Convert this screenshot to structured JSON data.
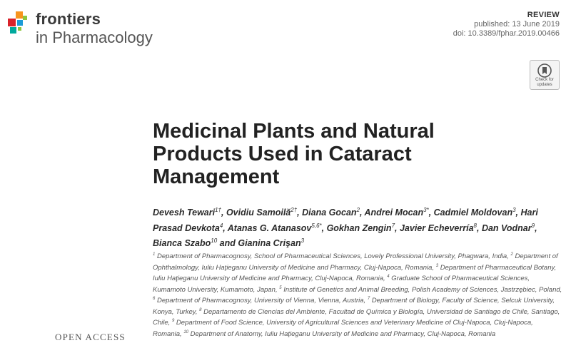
{
  "header": {
    "brand": "frontiers",
    "journal": "in Pharmacology",
    "article_type": "REVIEW",
    "published": "published: 13 June 2019",
    "doi": "doi: 10.3389/fphar.2019.00466"
  },
  "check_updates": {
    "label": "Check for updates"
  },
  "article": {
    "title": "Medicinal Plants and Natural Products Used in Cataract Management"
  },
  "authors": [
    {
      "name": "Devesh Tewari",
      "sup": "1†",
      "sep": ", "
    },
    {
      "name": "Ovidiu Samoilă",
      "sup": "2†",
      "sep": ", "
    },
    {
      "name": "Diana Gocan",
      "sup": "2",
      "sep": ", "
    },
    {
      "name": "Andrei Mocan",
      "sup": "3*",
      "sep": ", "
    },
    {
      "name": "Cadmiel Moldovan",
      "sup": "3",
      "sep": ", "
    },
    {
      "name": "Hari Prasad Devkota",
      "sup": "4",
      "sep": ", "
    },
    {
      "name": "Atanas G. Atanasov",
      "sup": "5,6*",
      "sep": ", "
    },
    {
      "name": "Gokhan Zengin",
      "sup": "7",
      "sep": ", "
    },
    {
      "name": "Javier Echeverría",
      "sup": "8",
      "sep": ", "
    },
    {
      "name": "Dan Vodnar",
      "sup": "9",
      "sep": ", "
    },
    {
      "name": "Bianca Szabo",
      "sup": "10",
      "sep": " and "
    },
    {
      "name": "Gianina Crişan",
      "sup": "3",
      "sep": ""
    }
  ],
  "affiliations": [
    {
      "num": "1",
      "text": "Department of Pharmacognosy, School of Pharmaceutical Sciences, Lovely Professional University, Phagwara, India,"
    },
    {
      "num": "2",
      "text": "Department of Ophthalmology, Iuliu Haţieganu University of Medicine and Pharmacy, Cluj-Napoca, Romania,"
    },
    {
      "num": "3",
      "text": "Department of Pharmaceutical Botany, Iuliu Haţieganu University of Medicine and Pharmacy, Cluj-Napoca, Romania,"
    },
    {
      "num": "4",
      "text": "Graduate School of Pharmaceutical Sciences, Kumamoto University, Kumamoto, Japan,"
    },
    {
      "num": "5",
      "text": "Institute of Genetics and Animal Breeding, Polish Academy of Sciences, Jastrzębiec, Poland,"
    },
    {
      "num": "6",
      "text": "Department of Pharmacognosy, University of Vienna, Vienna, Austria,"
    },
    {
      "num": "7",
      "text": "Department of Biology, Faculty of Science, Selcuk University, Konya, Turkey,"
    },
    {
      "num": "8",
      "text": "Departamento de Ciencias del Ambiente, Facultad de Química y Biología, Universidad de Santiago de Chile, Santiago, Chile,"
    },
    {
      "num": "9",
      "text": "Department of Food Science, University of Agricultural Sciences and Veterinary Medicine of Cluj-Napoca, Cluj-Napoca, Romania,"
    },
    {
      "num": "10",
      "text": "Department of Anatomy, Iuliu Haţieganu University of Medicine and Pharmacy, Cluj-Napoca, Romania"
    }
  ],
  "sidebar": {
    "open_access": "OPEN ACCESS"
  },
  "colors": {
    "logo_orange": "#f7941d",
    "logo_red": "#d9222a",
    "logo_blue": "#1b9bd7",
    "logo_green": "#8dc63f",
    "logo_teal": "#00a99d"
  }
}
